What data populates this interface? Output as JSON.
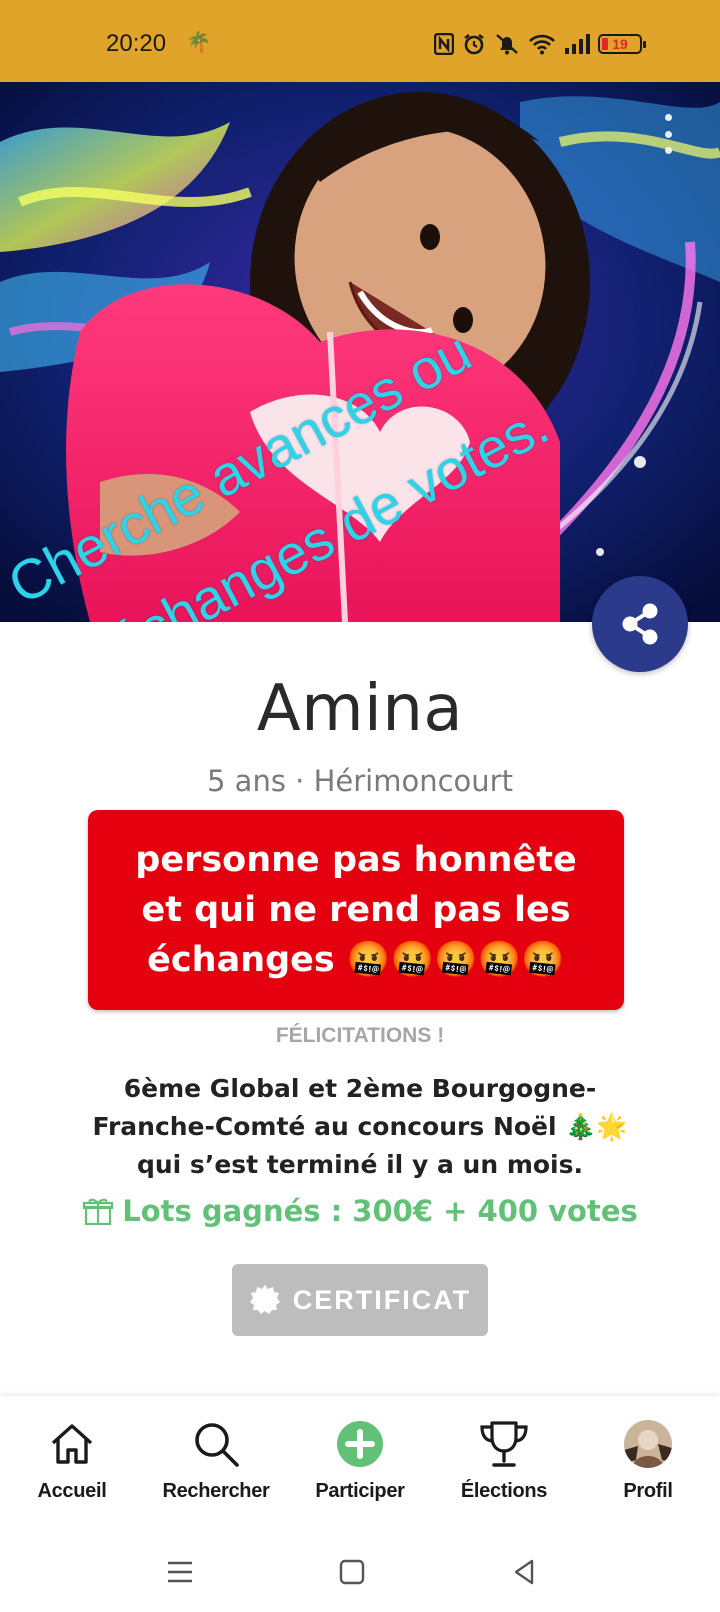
{
  "status_bar": {
    "time": "20:20",
    "time_emoji": "🌴",
    "battery_level": "19",
    "background_color": "#e0a42a"
  },
  "hero": {
    "caption_line1": "Cherche avances ou",
    "caption_line2": "échanges de votes.",
    "menu_icon": "more-vertical-icon"
  },
  "profile": {
    "name": "Amina",
    "meta": "5 ans · Hérimoncourt",
    "alert_text": "personne pas honnête et qui ne rend pas les échanges 🤬🤬🤬🤬🤬",
    "alert_color": "#e4000f"
  },
  "congrats": {
    "label": "FÉLICITATIONS !",
    "text": "6ème Global et 2ème Bourgogne-Franche-Comté au concours Noël 🎄🌟 qui s’est terminé il y a un mois.",
    "prizes": "Lots gagnés : 300€ + 400 votes",
    "prizes_color": "#62c177"
  },
  "certificate": {
    "label": "CERTIFICAT"
  },
  "bottom_nav": {
    "items": [
      {
        "label": "Accueil",
        "icon": "home-icon"
      },
      {
        "label": "Rechercher",
        "icon": "search-icon"
      },
      {
        "label": "Participer",
        "icon": "plus-circle-icon"
      },
      {
        "label": "Élections",
        "icon": "trophy-icon"
      },
      {
        "label": "Profil",
        "icon": "avatar"
      }
    ]
  },
  "accent_colors": {
    "share": "#2c3a8c",
    "participate": "#62c177"
  }
}
